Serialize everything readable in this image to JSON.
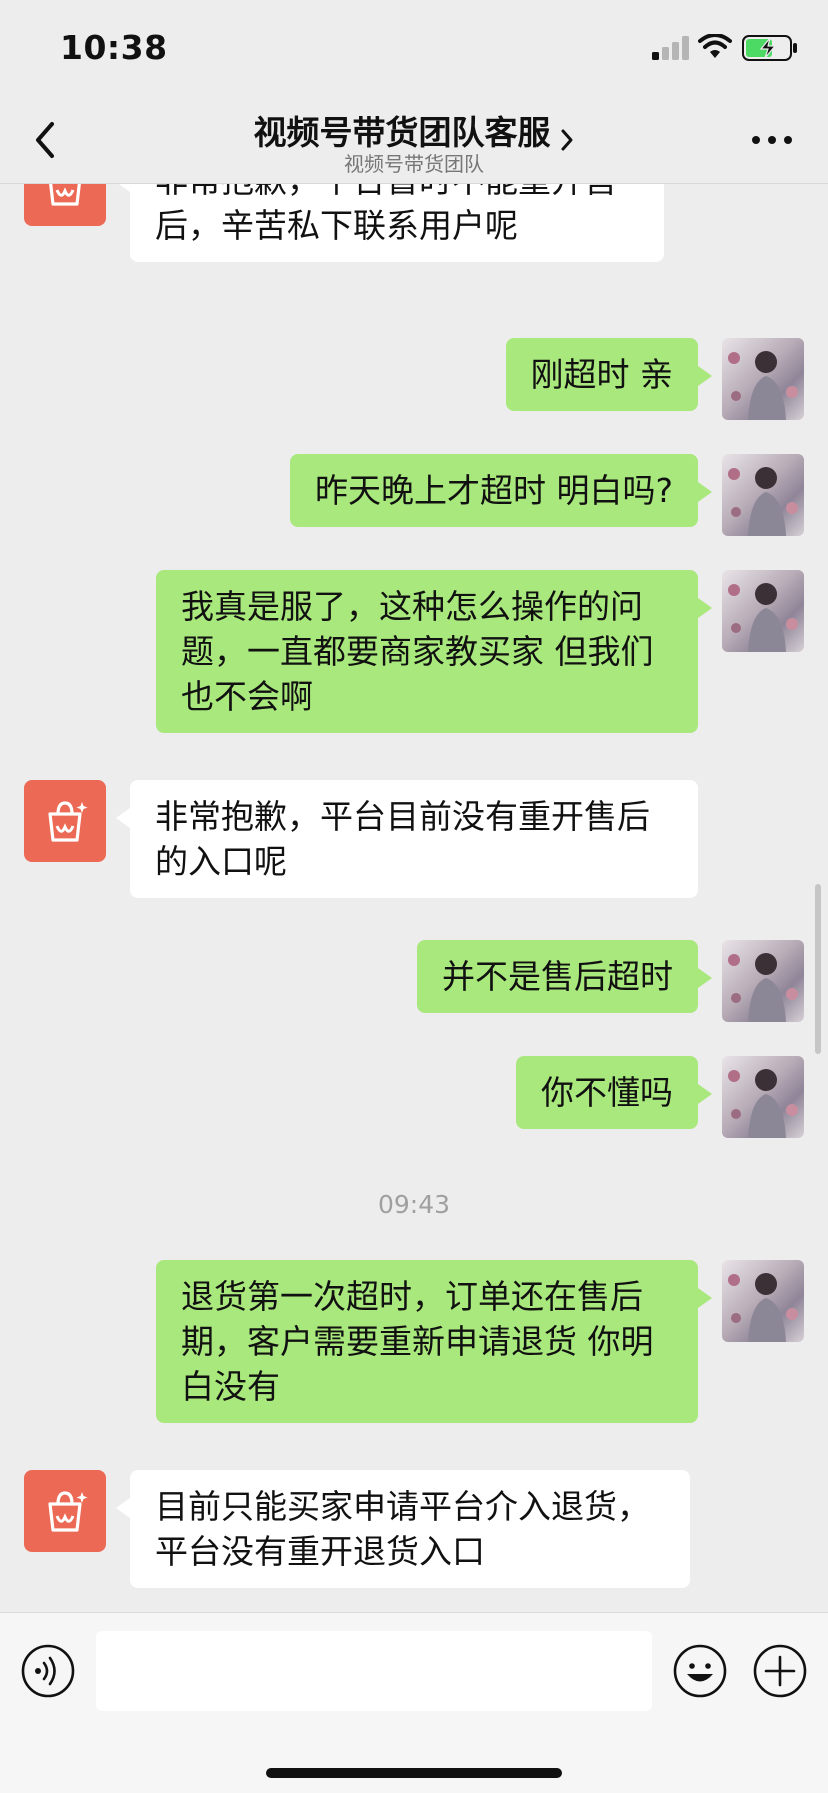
{
  "status_bar": {
    "time": "10:38",
    "icons": [
      "signal-icon",
      "wifi-icon",
      "battery-charging-icon"
    ]
  },
  "nav": {
    "title": "视频号带货团队客服",
    "subtitle": "视频号带货团队",
    "icons": [
      "back-icon",
      "chevron-right-icon",
      "more-icon"
    ]
  },
  "messages": [
    {
      "side": "in",
      "text": "非常抱歉，平台暂时不能重开售后，辛苦私下联系用户呢"
    },
    {
      "side": "out",
      "text": "刚超时 亲"
    },
    {
      "side": "out",
      "text": "昨天晚上才超时  明白吗?"
    },
    {
      "side": "out",
      "text": "我真是服了，这种怎么操作的问题，一直都要商家教买家 但我们也不会啊"
    },
    {
      "side": "in",
      "text": "非常抱歉，平台目前没有重开售后的入口呢"
    },
    {
      "side": "out",
      "text": "并不是售后超时"
    },
    {
      "side": "out",
      "text": "你不懂吗"
    },
    {
      "side": "time",
      "text": "09:43"
    },
    {
      "side": "out",
      "text": "退货第一次超时，订单还在售后期，客户需要重新申请退货 你明白没有"
    },
    {
      "side": "in",
      "text": "目前只能买家申请平台介入退货，平台没有重开退货入口"
    }
  ],
  "input_bar": {
    "value": "",
    "icons": [
      "voice-icon",
      "emoji-icon",
      "plus-icon"
    ]
  },
  "colors": {
    "background": "#ededed",
    "outgoing_bubble": "#a9e87c",
    "incoming_bubble": "#ffffff",
    "bot_avatar": "#ec6a55",
    "battery_fill": "#4cd964"
  }
}
